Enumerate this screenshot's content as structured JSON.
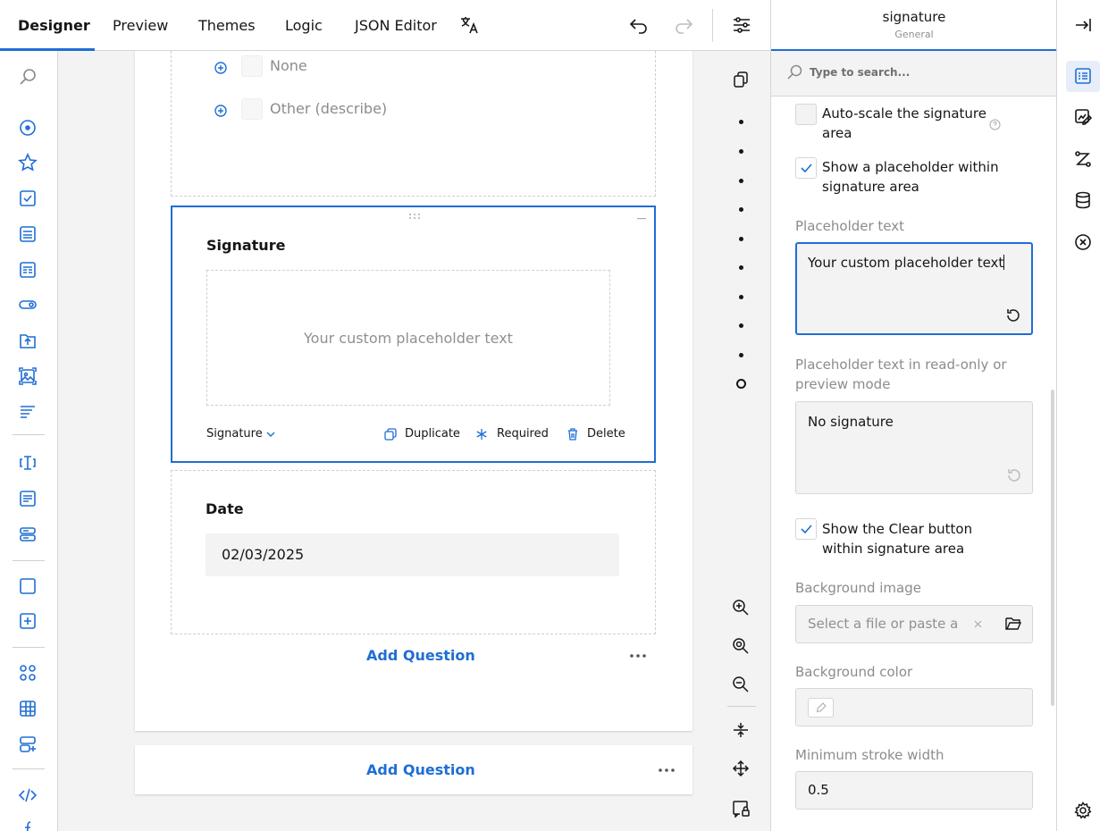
{
  "tabs": [
    {
      "label": "Designer",
      "active": true
    },
    {
      "label": "Preview"
    },
    {
      "label": "Themes"
    },
    {
      "label": "Logic"
    },
    {
      "label": "JSON Editor"
    }
  ],
  "surface": {
    "choices": [
      "None",
      "Other (describe)"
    ],
    "signature_question": {
      "title": "Signature",
      "placeholder": "Your custom placeholder text",
      "type_label": "Signature",
      "actions": {
        "duplicate": "Duplicate",
        "required": "Required",
        "delete": "Delete"
      }
    },
    "date_question": {
      "title": "Date",
      "value": "02/03/2025"
    },
    "add_question": "Add Question",
    "add_question_bottom": "Add Question"
  },
  "properties": {
    "title": "signature",
    "subtitle": "General",
    "search_placeholder": "Type to search...",
    "auto_scale": {
      "label": "Auto-scale the signature area",
      "checked": false
    },
    "show_placeholder": {
      "label": "Show a placeholder within signature area",
      "checked": true
    },
    "placeholder_label": "Placeholder text",
    "placeholder_value": "Your custom placeholder text",
    "readonly_label": "Placeholder text in read-only or preview mode",
    "readonly_value": "No signature",
    "show_clear": {
      "label": "Show the Clear button within signature area",
      "checked": true
    },
    "bg_image_label": "Background image",
    "bg_image_placeholder": "Select a file or paste a",
    "bg_color_label": "Background color",
    "min_stroke_label": "Minimum stroke width",
    "min_stroke_value": "0.5"
  },
  "colors": {
    "accent": "#1f6ed4",
    "text": "#161616",
    "muted": "#909090"
  }
}
